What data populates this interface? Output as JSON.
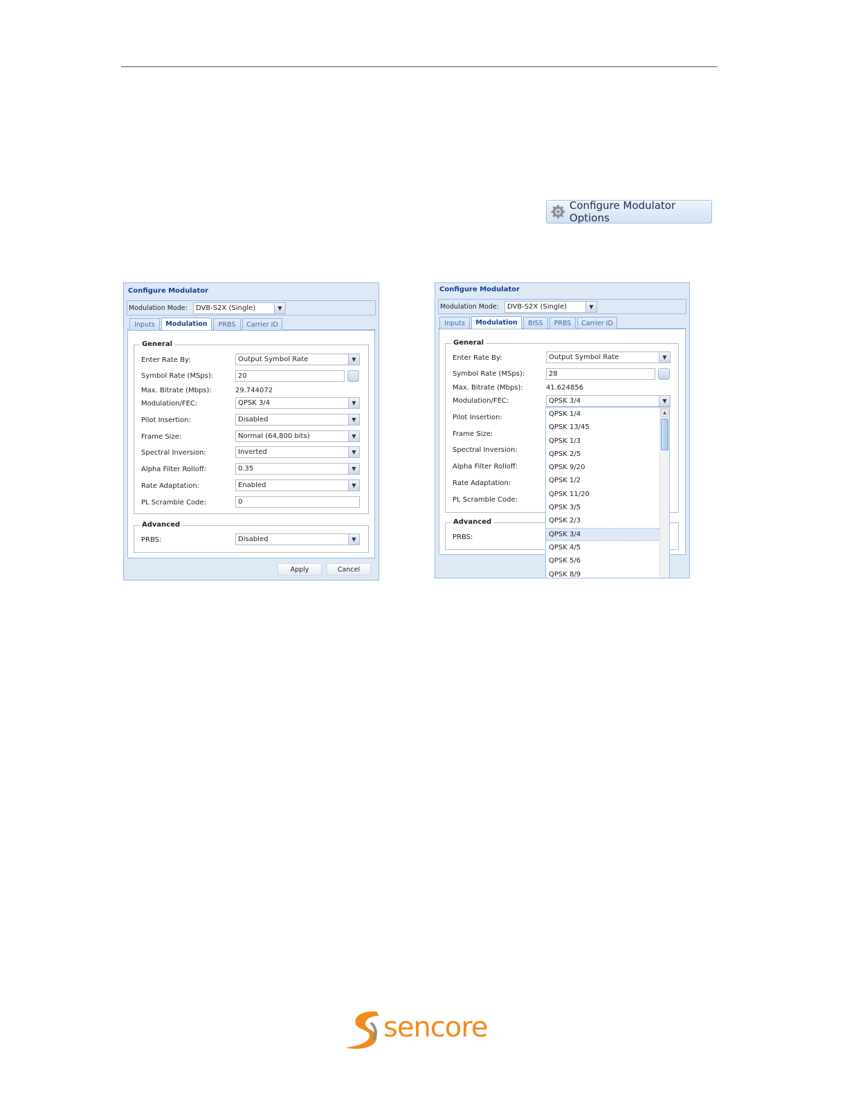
{
  "configure_button": {
    "label": "Configure Modulator Options",
    "icon": "gear-icon"
  },
  "dialog_left": {
    "title": "Configure Modulator",
    "modulation_mode_label": "Modulation Mode:",
    "modulation_mode_value": "DVB-S2X (Single)",
    "tabs": [
      "Inputs",
      "Modulation",
      "PRBS",
      "Carrier ID"
    ],
    "general_legend": "General",
    "fields": {
      "enter_rate_by": {
        "label": "Enter Rate By:",
        "value": "Output Symbol Rate"
      },
      "symbol_rate": {
        "label": "Symbol Rate (MSps):",
        "value": "20"
      },
      "max_bitrate": {
        "label": "Max. Bitrate (Mbps):",
        "value": "29.744072"
      },
      "modulation_fec": {
        "label": "Modulation/FEC:",
        "value": "QPSK 3/4"
      },
      "pilot_insertion": {
        "label": "Pilot Insertion:",
        "value": "Disabled"
      },
      "frame_size": {
        "label": "Frame Size:",
        "value": "Normal (64,800 bits)"
      },
      "spectral_inversion": {
        "label": "Spectral Inversion:",
        "value": "Inverted"
      },
      "alpha_rolloff": {
        "label": "Alpha Filter Rolloff:",
        "value": "0.35"
      },
      "rate_adaptation": {
        "label": "Rate Adaptation:",
        "value": "Enabled"
      },
      "pl_scramble": {
        "label": "PL Scramble Code:",
        "value": "0"
      }
    },
    "advanced_legend": "Advanced",
    "prbs": {
      "label": "PRBS:",
      "value": "Disabled"
    },
    "apply_label": "Apply",
    "cancel_label": "Cancel"
  },
  "dialog_right": {
    "title": "Configure Modulator",
    "modulation_mode_label": "Modulation Mode:",
    "modulation_mode_value": "DVB-S2X (Single)",
    "tabs": [
      "Inputs",
      "Modulation",
      "BISS",
      "PRBS",
      "Carrier ID"
    ],
    "general_legend": "General",
    "fields": {
      "enter_rate_by": {
        "label": "Enter Rate By:",
        "value": "Output Symbol Rate"
      },
      "symbol_rate": {
        "label": "Symbol Rate (MSps):",
        "value": "28"
      },
      "max_bitrate": {
        "label": "Max. Bitrate (Mbps):",
        "value": "41.624856"
      },
      "modulation_fec": {
        "label": "Modulation/FEC:",
        "value": "QPSK 3/4"
      },
      "pilot_insertion": {
        "label": "Pilot Insertion:"
      },
      "frame_size": {
        "label": "Frame Size:"
      },
      "spectral_inversion": {
        "label": "Spectral Inversion:"
      },
      "alpha_rolloff": {
        "label": "Alpha Filter Rolloff:"
      },
      "rate_adaptation": {
        "label": "Rate Adaptation:"
      },
      "pl_scramble": {
        "label": "PL Scramble Code:"
      }
    },
    "advanced_legend": "Advanced",
    "prbs": {
      "label": "PRBS:"
    },
    "fec_options": [
      "QPSK 1/4",
      "QPSK 13/45",
      "QPSK 1/3",
      "QPSK 2/5",
      "QPSK 9/20",
      "QPSK 1/2",
      "QPSK 11/20",
      "QPSK 3/5",
      "QPSK 2/3",
      "QPSK 3/4",
      "QPSK 4/5",
      "QPSK 5/6",
      "QPSK 8/9"
    ],
    "fec_selected": "QPSK 3/4"
  },
  "logo": {
    "text": "sencore"
  }
}
